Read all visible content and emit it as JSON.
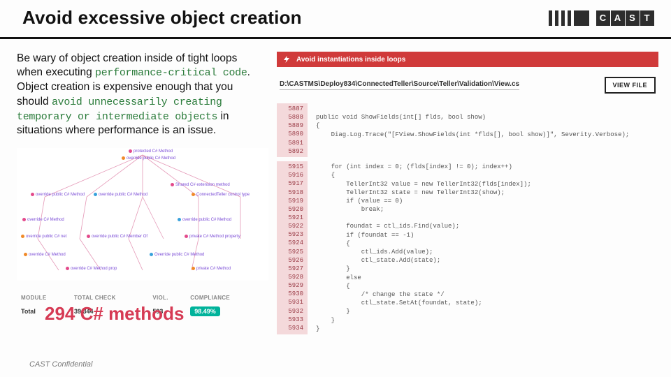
{
  "header": {
    "title": "Avoid excessive object creation",
    "logo_letters": {
      "c": "C",
      "a": "A",
      "s": "S",
      "t": "T"
    }
  },
  "intro": {
    "part1": "Be wary of object creation inside of tight loops when executing ",
    "mono1": "performance-critical code",
    "part2": ". Object creation is expensive enough that you should ",
    "mono2": "avoid unnecessarily creating temporary or intermediate objects",
    "part3": " in situations where performance is an issue."
  },
  "diagram_overlay": "294 C# methods",
  "stats": {
    "headers": {
      "module": "MODULE",
      "total": "TOTAL CHECK",
      "viol": "VIOL.",
      "compliance": "COMPLIANCE"
    },
    "row": {
      "module": "Total",
      "total": "39,344",
      "viol": "593",
      "compliance": "98.49%"
    }
  },
  "rule": {
    "label": "Avoid instantiations inside loops",
    "file_path": "D:\\CASTMS\\Deploy834\\ConnectedTeller\\Source\\Teller\\Validation\\View.cs",
    "view_file": "VIEW FILE"
  },
  "code": {
    "gutter1": [
      "5887",
      "5888",
      "5889",
      "5890",
      "5891",
      "5892"
    ],
    "gutter2": [
      "5915",
      "5916",
      "5917",
      "5918",
      "5919",
      "5920",
      "5921",
      "5922",
      "5923",
      "5924",
      "5925",
      "5926",
      "5927",
      "5928",
      "5929",
      "5930",
      "5931",
      "5932",
      "5933",
      "5934"
    ],
    "lines1": [
      "",
      "public void ShowFields(int[] flds, bool show)",
      "{",
      "    Diag.Log.Trace(\"[FView.ShowFields(int *flds[], bool show)]\", Severity.Verbose);",
      "",
      ""
    ],
    "lines2": [
      "    for (int index = 0; (flds[index] != 0); index++)",
      "    {",
      "        TellerInt32 value = new TellerInt32(flds[index]);",
      "        TellerInt32 state = new TellerInt32(show);",
      "        if (value == 0)",
      "            break;",
      "",
      "        foundat = ctl_ids.Find(value);",
      "        if (foundat == -1)",
      "        {",
      "            ctl_ids.Add(value);",
      "            ctl_state.Add(state);",
      "        }",
      "        else",
      "        {",
      "            /* change the state */",
      "            ctl_state.SetAt(foundat, state);",
      "        }",
      "    }",
      "}"
    ]
  },
  "footer": "CAST Confidential"
}
